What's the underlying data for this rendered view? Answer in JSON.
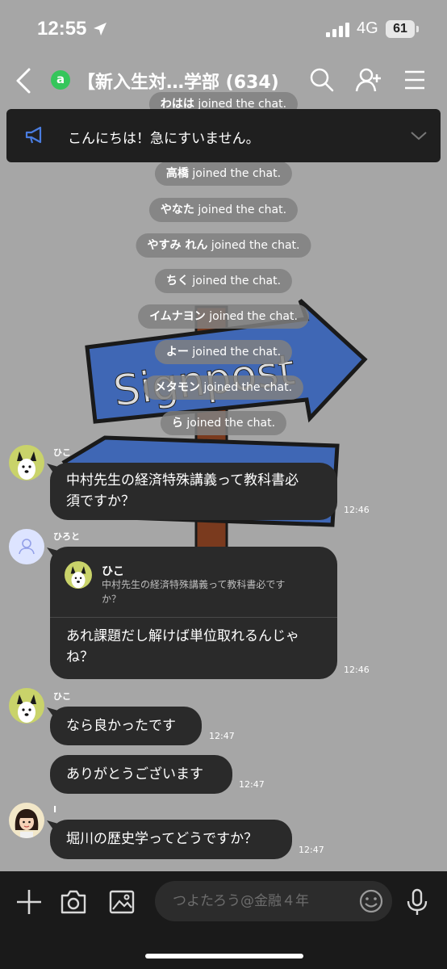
{
  "status": {
    "time": "12:55",
    "network": "4G",
    "battery": "61"
  },
  "header": {
    "badge": "a",
    "title": "【新入生対…学部 (634)"
  },
  "announcement": {
    "text": "こんにちは！急にすいません。"
  },
  "system_messages": [
    {
      "name": "わはは",
      "suffix": " joined the chat."
    },
    {
      "name": "高橋",
      "suffix": " joined the chat."
    },
    {
      "name": "やなた",
      "suffix": " joined the chat."
    },
    {
      "name": "やすみ れん",
      "suffix": " joined the chat."
    },
    {
      "name": "ちく",
      "suffix": " joined the chat."
    },
    {
      "name": "イムナヨン",
      "suffix": " joined the chat."
    },
    {
      "name": "よー",
      "suffix": " joined the chat."
    },
    {
      "name": "メタモン",
      "suffix": " joined the chat."
    },
    {
      "name": "ら",
      "suffix": " joined the chat."
    }
  ],
  "wallpaper": {
    "sign_text": "Signpost"
  },
  "messages": [
    {
      "sender": "ひこ",
      "text_line1": "中村先生の経済特殊講義って教科書必",
      "text_line2": "須ですか？",
      "time": "12:46"
    },
    {
      "sender": "ひろと",
      "reply_to": {
        "name": "ひこ",
        "quote_line1": "中村先生の経済特殊講義って教科書必です",
        "quote_line2": "か？"
      },
      "text_line1": "あれ課題だし解けば単位取れるんじゃ",
      "text_line2": "ね？",
      "time": "12:46"
    },
    {
      "sender": "ひこ",
      "text": "なら良かったです",
      "time": "12:47"
    },
    {
      "text": "ありがとうございます",
      "time": "12:47"
    },
    {
      "sender": "I",
      "text": "堀川の歴史学ってどうですか？",
      "time": "12:47"
    }
  ],
  "input": {
    "placeholder": "つよたろう@金融４年"
  },
  "colors": {
    "background": "#a6a6a6",
    "bubble": "#2a2a2a",
    "badge": "#35c65b",
    "announcement_icon": "#4a7de0"
  },
  "icons": [
    "back-icon",
    "search-icon",
    "add-friend-icon",
    "menu-icon",
    "megaphone-icon",
    "chevron-down-icon",
    "plus-icon",
    "camera-icon",
    "image-icon",
    "emoji-icon",
    "microphone-icon"
  ]
}
